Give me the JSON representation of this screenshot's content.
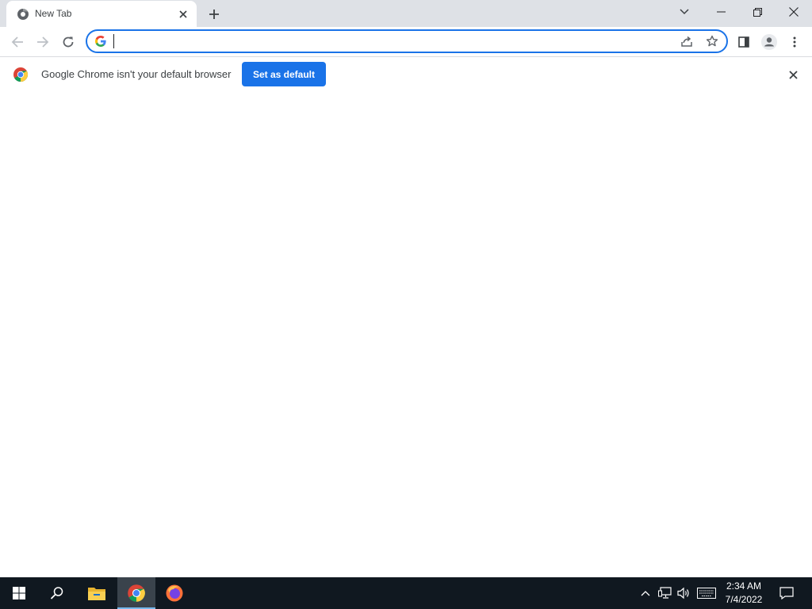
{
  "tab": {
    "title": "New Tab"
  },
  "omnibox": {
    "value": "",
    "placeholder": ""
  },
  "infobar": {
    "message": "Google Chrome isn't your default browser",
    "button_label": "Set as default"
  },
  "taskbar": {
    "time": "2:34 AM",
    "date": "7/4/2022",
    "pinned": [
      "start-icon",
      "search-icon",
      "file-explorer-icon",
      "chrome-icon",
      "firefox-icon"
    ],
    "active_app": "chrome"
  },
  "colors": {
    "accent": "#1a73e8",
    "tabstrip": "#dee1e6",
    "taskbar": "#101820"
  }
}
